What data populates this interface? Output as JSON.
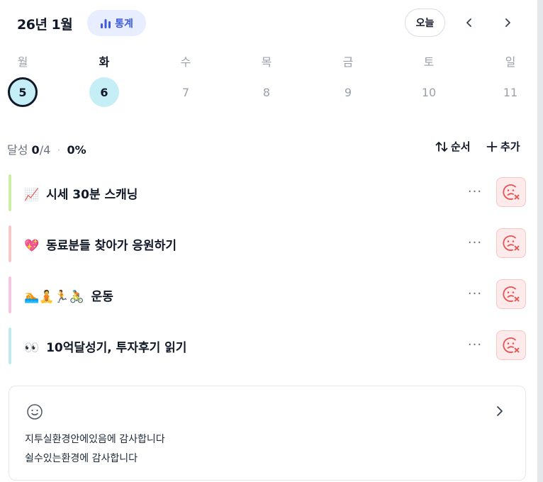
{
  "header": {
    "month_title": "26년 1월",
    "stats_label": "통계",
    "today_label": "오늘",
    "prev_icon": "chevron-left-icon",
    "next_icon": "chevron-right-icon"
  },
  "week": {
    "days": [
      {
        "weekday": "월",
        "date": "5",
        "state": "selected"
      },
      {
        "weekday": "화",
        "date": "6",
        "state": "today"
      },
      {
        "weekday": "수",
        "date": "7",
        "state": "normal"
      },
      {
        "weekday": "목",
        "date": "8",
        "state": "normal"
      },
      {
        "weekday": "금",
        "date": "9",
        "state": "normal"
      },
      {
        "weekday": "토",
        "date": "10",
        "state": "normal"
      },
      {
        "weekday": "일",
        "date": "11",
        "state": "normal"
      }
    ]
  },
  "progress": {
    "label": "달성",
    "done": "0",
    "total": "/4",
    "separator": "·",
    "percent": "0%"
  },
  "toolbar": {
    "sort_label": "순서",
    "add_label": "추가"
  },
  "habits": [
    {
      "emoji": "📈",
      "title": "시세 30분 스캐닝",
      "color": "#cdeea6"
    },
    {
      "emoji": "💖",
      "title": "동료분들 찾아가 응원하기",
      "color": "#f9c9c9"
    },
    {
      "emoji": "🏊🧘🏃🚴",
      "title": "운동",
      "color": "#f6c6e0"
    },
    {
      "emoji": "👀",
      "title": "10억달성기, 투자후기 읽기",
      "color": "#bfeaf0"
    }
  ],
  "more_label": "···",
  "gratitude": {
    "line1": "지투실환경안에있음에 감사합니다",
    "line2": "쉴수있는환경에 감사합니다"
  },
  "colors": {
    "accent": "#3b5bdb",
    "today_bg": "#c5eef7",
    "skip_bg": "#fdeaea",
    "skip_icon": "#e55353"
  }
}
